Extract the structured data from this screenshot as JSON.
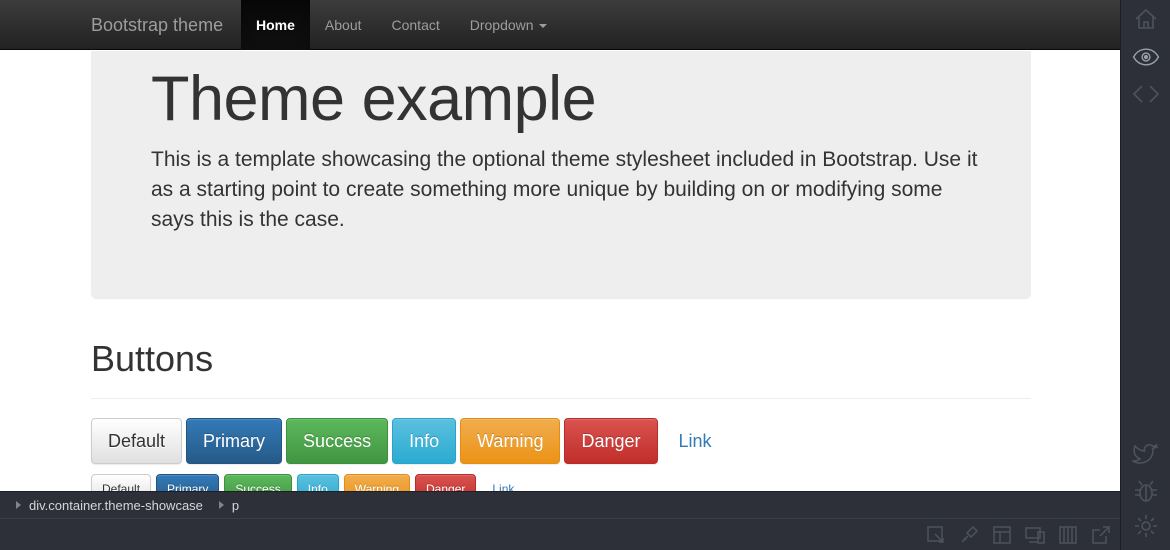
{
  "navbar": {
    "brand": "Bootstrap theme",
    "items": [
      {
        "label": "Home",
        "active": true
      },
      {
        "label": "About",
        "active": false
      },
      {
        "label": "Contact",
        "active": false
      },
      {
        "label": "Dropdown",
        "active": false,
        "dropdown": true
      }
    ]
  },
  "jumbotron": {
    "title": "Theme example",
    "text": "This is a template showcasing the optional theme stylesheet included in Bootstrap. Use it as a starting point to create something more unique by building on or modifying some says this is the case."
  },
  "buttons_section": {
    "title": "Buttons",
    "large": [
      "Default",
      "Primary",
      "Success",
      "Info",
      "Warning",
      "Danger",
      "Link"
    ],
    "small": [
      "Default",
      "Primary",
      "Success",
      "Info",
      "Warning",
      "Danger",
      "Link"
    ]
  },
  "breadcrumb": {
    "items": [
      "div.container.theme-showcase",
      "p"
    ]
  },
  "sidebar": {
    "icons": [
      "home-icon",
      "eye-icon",
      "code-icon",
      "twitter-icon",
      "bug-icon",
      "gear-icon"
    ]
  },
  "bottom_toolbar": {
    "icons": [
      "inspect-icon",
      "paint-icon",
      "layout-icon",
      "devices-icon",
      "grid-icon",
      "external-link-icon"
    ]
  },
  "colors": {
    "navbar": "#222222",
    "jumbotron": "#eeeeee",
    "primary": "#337ab7",
    "success": "#5cb85c",
    "info": "#5bc0de",
    "warning": "#f0ad4e",
    "danger": "#d9534f",
    "panel": "#2d3039"
  }
}
